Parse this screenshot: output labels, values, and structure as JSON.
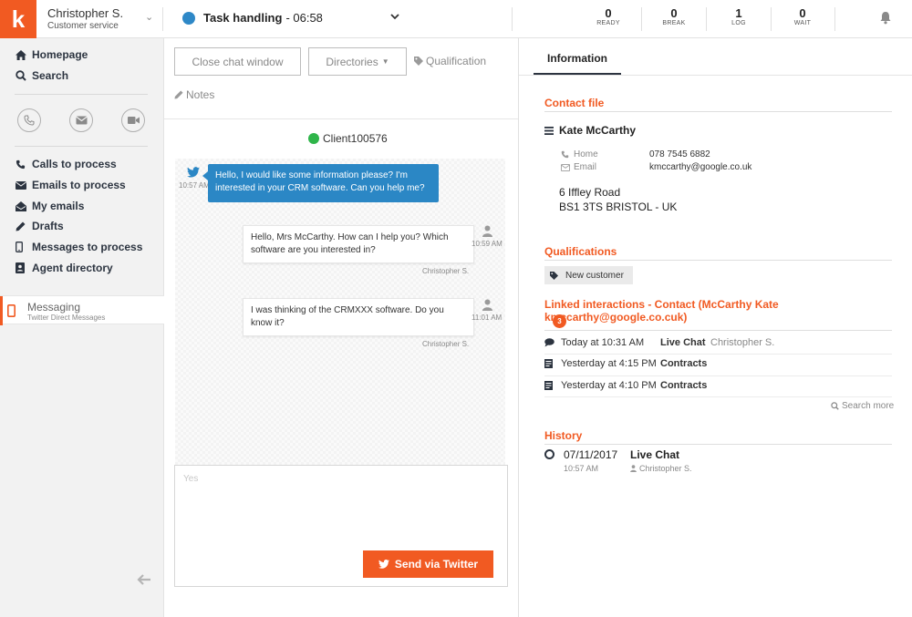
{
  "header": {
    "logo_letter": "k",
    "user_name": "Christopher S.",
    "user_role": "Customer service",
    "task_label": "Task handling",
    "task_time": "- 06:58",
    "counters": [
      {
        "value": "0",
        "label": "READY"
      },
      {
        "value": "0",
        "label": "BREAK"
      },
      {
        "value": "1",
        "label": "LOG"
      },
      {
        "value": "0",
        "label": "WAIT"
      }
    ]
  },
  "sidebar": {
    "top_items": [
      {
        "label": "Homepage",
        "icon": "home-icon"
      },
      {
        "label": "Search",
        "icon": "search-icon"
      }
    ],
    "channel_buttons": [
      "phone-icon",
      "email-icon",
      "video-icon"
    ],
    "items": [
      {
        "label": "Calls to process",
        "icon": "phone-icon"
      },
      {
        "label": "Emails to process",
        "icon": "envelope-icon"
      },
      {
        "label": "My emails",
        "icon": "inbox-icon"
      },
      {
        "label": "Drafts",
        "icon": "pencil-icon"
      },
      {
        "label": "Messages to process",
        "icon": "mobile-icon"
      },
      {
        "label": "Agent directory",
        "icon": "contacts-icon"
      }
    ],
    "active_tab": {
      "title": "Messaging",
      "subtitle": "Twitter Direct Messages"
    }
  },
  "center": {
    "close_button": "Close chat window",
    "directories_button": "Directories",
    "qualification_link": "Qualification",
    "notes_link": "Notes",
    "client_name": "Client100576",
    "messages": [
      {
        "direction": "in",
        "text": "Hello, I would like some information please? I'm interested in your CRM software. Can you help me?",
        "time": "10:57 AM"
      },
      {
        "direction": "out",
        "text": "Hello, Mrs McCarthy. How can I help you? Which software are you interested in?",
        "time": "10:59 AM",
        "sender": "Christopher S."
      },
      {
        "direction": "out",
        "text": "I was thinking of the CRMXXX software. Do you know it?",
        "time": "11:01 AM",
        "sender": "Christopher S."
      }
    ],
    "compose_placeholder": "Yes",
    "send_button": "Send via Twitter"
  },
  "info": {
    "tab": "Information",
    "contact_file_title": "Contact file",
    "contact_name": "Kate McCarthy",
    "home_label": "Home",
    "home_value": "078 7545 6882",
    "email_label": "Email",
    "email_value": "kmccarthy@google.co.uk",
    "address_line1": "6 Iffley Road",
    "address_line2": "BS1 3TS BRISTOL - UK",
    "qualifications_title": "Qualifications",
    "qualification_tag": "New customer",
    "linked_title": "Linked interactions - Contact (McCarthy Kate kmccarthy@google.co.cuk)",
    "linked_count": "3",
    "linked": [
      {
        "when": "Today at 10:31 AM",
        "type": "Live Chat",
        "agent": "Christopher S.",
        "icon": "chat-icon"
      },
      {
        "when": "Yesterday at 4:15 PM",
        "type": "Contracts",
        "agent": "",
        "icon": "document-icon"
      },
      {
        "when": "Yesterday at 4:10 PM",
        "type": "Contracts",
        "agent": "",
        "icon": "document-icon"
      }
    ],
    "search_more": "Search more",
    "history_title": "History",
    "history": {
      "date": "07/11/2017",
      "type": "Live Chat",
      "time": "10:57 AM",
      "agent": "Christopher S."
    }
  },
  "colors": {
    "accent": "#f15a22",
    "twitter_blue": "#2b87c5",
    "online_green": "#2fb54a"
  }
}
